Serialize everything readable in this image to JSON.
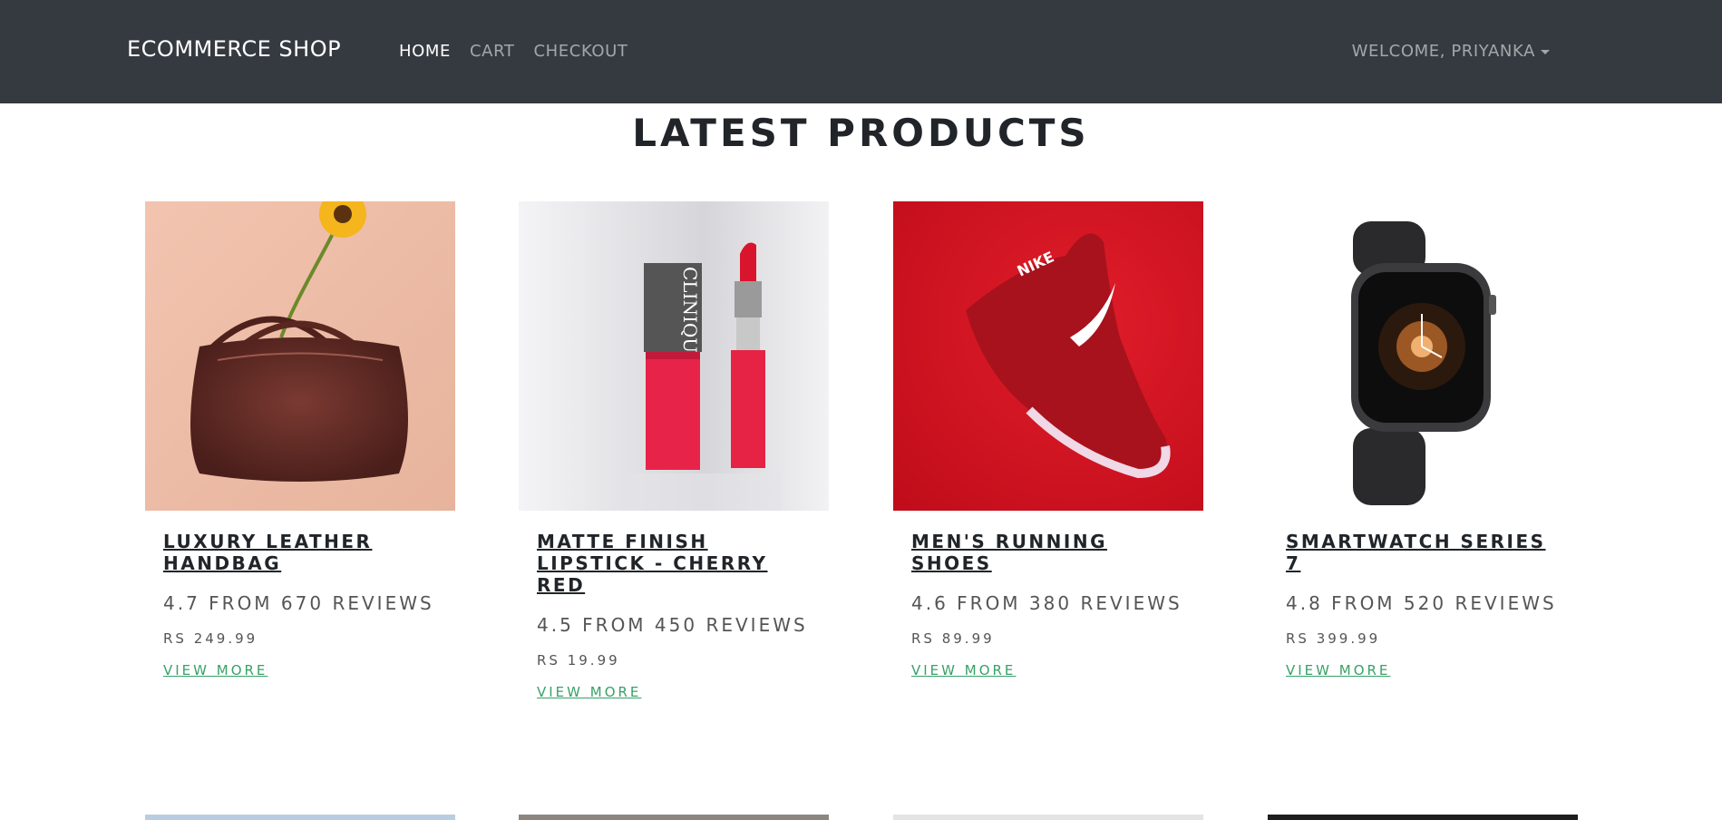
{
  "navbar": {
    "brand": "ECOMMERCE SHOP",
    "links": [
      {
        "label": "HOME",
        "active": true
      },
      {
        "label": "CART",
        "active": false
      },
      {
        "label": "CHECKOUT",
        "active": false
      }
    ],
    "user": "WELCOME, PRIYANKA"
  },
  "page": {
    "title": "LATEST PRODUCTS"
  },
  "products": [
    {
      "title": "LUXURY LEATHER HANDBAG",
      "rating": "4.7 FROM 670 REVIEWS",
      "price": "RS 249.99",
      "link": "VIEW MORE"
    },
    {
      "title": "MATTE FINISH LIPSTICK - CHERRY RED",
      "rating": "4.5 FROM 450 REVIEWS",
      "price": "RS 19.99",
      "link": "VIEW MORE"
    },
    {
      "title": "MEN'S RUNNING SHOES",
      "rating": "4.6 FROM 380 REVIEWS",
      "price": "RS 89.99",
      "link": "VIEW MORE"
    },
    {
      "title": "SMARTWATCH SERIES 7",
      "rating": "4.8 FROM 520 REVIEWS",
      "price": "RS 399.99",
      "link": "VIEW MORE"
    }
  ],
  "product_images": {
    "lipstick_brand": "CLINIQUE",
    "shoe_brand": "NIKE"
  },
  "colors": {
    "navbar_bg": "#343a40",
    "link_green": "#38a169",
    "bag_bg": "#efbda8",
    "shoe_bg": "#d3121f"
  }
}
